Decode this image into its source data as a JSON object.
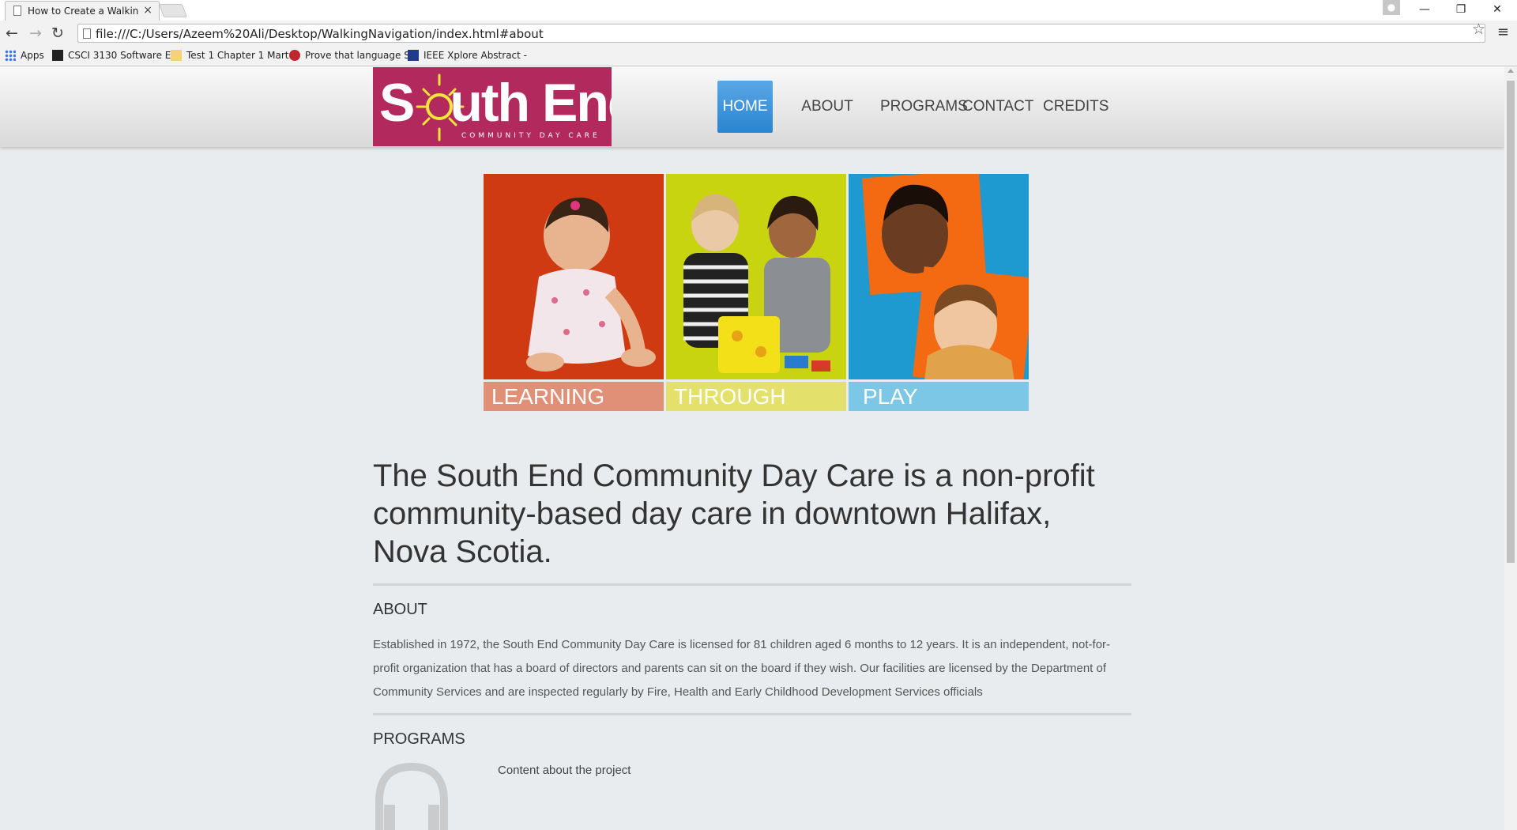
{
  "browser": {
    "tab_title": "How to Create a Walking",
    "url": "file:///C:/Users/Azeem%20Ali/Desktop/WalkingNavigation/index.html#about",
    "bookmarks": [
      {
        "label": "Apps"
      },
      {
        "label": "CSCI 3130 Software E"
      },
      {
        "label": "Test 1 Chapter 1 Mart"
      },
      {
        "label": "Prove that language S"
      },
      {
        "label": "IEEE Xplore Abstract -"
      }
    ]
  },
  "site": {
    "logo_text": "South End",
    "logo_subtext": "COMMUNITY DAY CARE",
    "nav": [
      {
        "label": "HOME",
        "active": true
      },
      {
        "label": "ABOUT",
        "active": false
      },
      {
        "label": "PROGRAMS",
        "active": false
      },
      {
        "label": "CONTACT",
        "active": false
      },
      {
        "label": "CREDITS",
        "active": false
      }
    ],
    "banner": [
      {
        "label": "LEARNING",
        "photo_color": "#cf3a12",
        "label_color": "#e09077"
      },
      {
        "label": "THROUGH",
        "photo_color": "#c8d40f",
        "label_color": "#e3e06c"
      },
      {
        "label": "PLAY",
        "photo_color": "#1e9ad0",
        "label_color": "#7cc7e6"
      }
    ],
    "headline": "The South End Community Day Care is a non-profit community-based day care in downtown Halifax, Nova Scotia.",
    "about": {
      "title": "ABOUT",
      "text": "Established in 1972, the South End Community Day Care is licensed for 81 children aged 6 months to 12 years. It is an independent, not-for-profit organization that has a board of directors and parents can sit on the board if they wish. Our facilities are licensed by the Department of Community Services and are inspected regularly by Fire, Health and Early Childhood Development Services officials"
    },
    "programs": {
      "title": "PROGRAMS",
      "text": "Content about the project"
    }
  }
}
